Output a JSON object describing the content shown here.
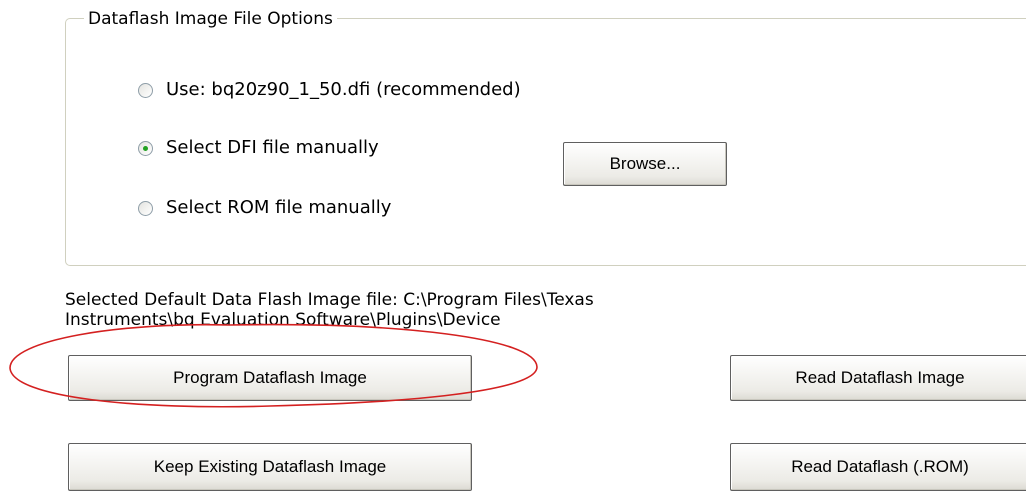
{
  "group": {
    "title": "Dataflash Image File Options"
  },
  "options": [
    {
      "label": "Use: bq20z90_1_50.dfi (recommended)",
      "checked": false
    },
    {
      "label": "Select DFI file manually",
      "checked": true
    },
    {
      "label": "Select ROM file manually",
      "checked": false
    }
  ],
  "browse_label": "Browse...",
  "selected_file": {
    "line1": "Selected Default Data Flash Image file: C:\\Program Files\\Texas",
    "line2": "Instruments\\bq Evaluation Software\\Plugins\\Device"
  },
  "buttons": {
    "program": "Program Dataflash Image",
    "read": "Read Dataflash Image",
    "keep": "Keep Existing Dataflash Image",
    "read_rom": "Read Dataflash (.ROM)"
  },
  "annotation_color": "#d42020"
}
